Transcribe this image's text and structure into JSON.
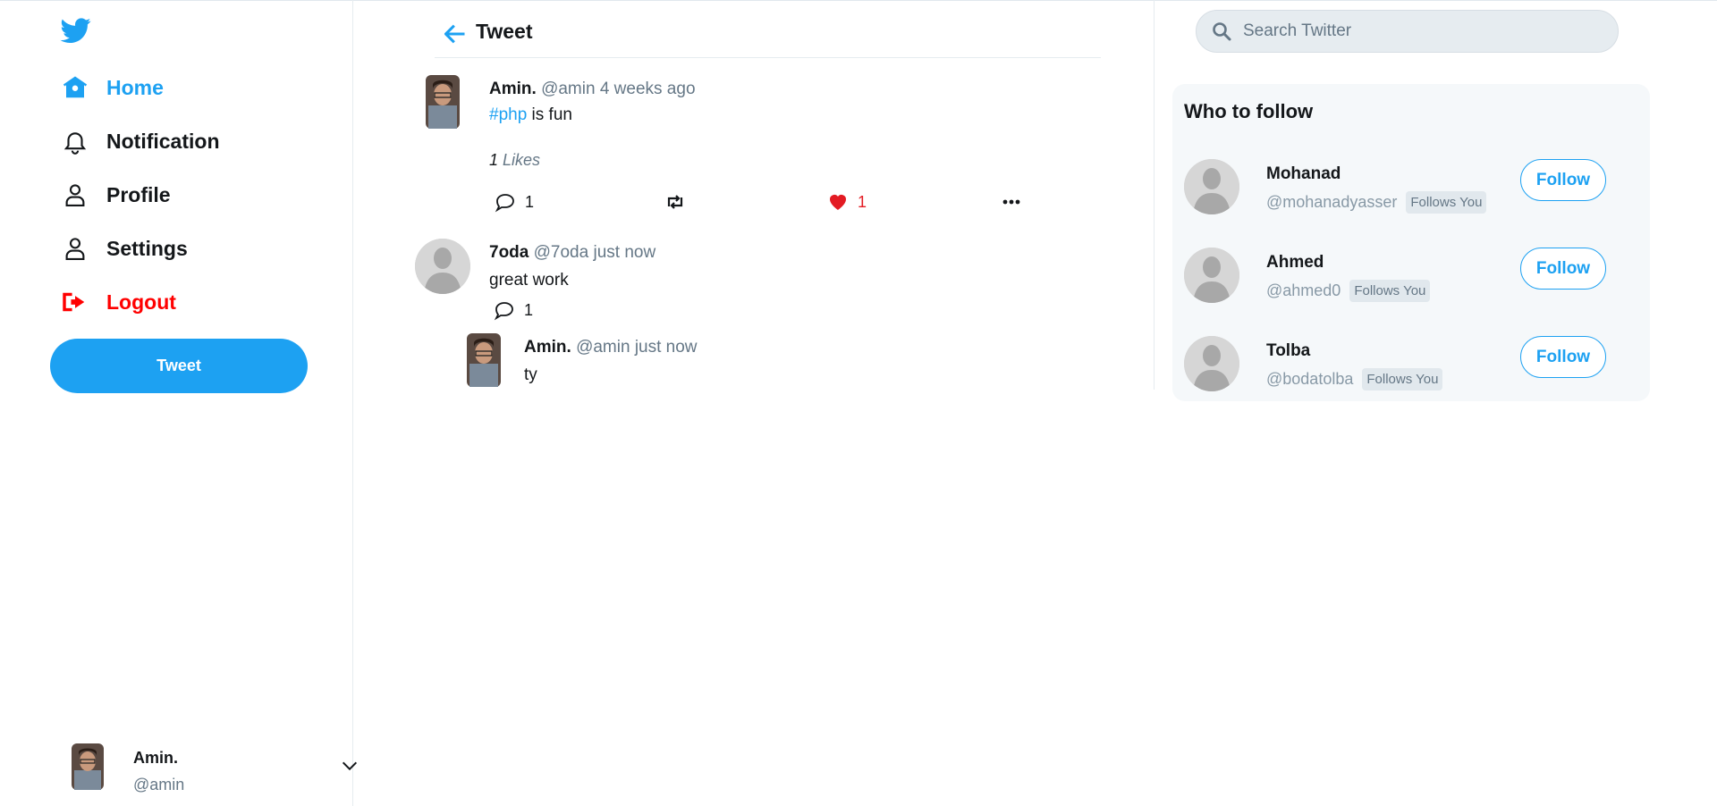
{
  "colors": {
    "accent": "#1da1f2",
    "danger": "#ff0000",
    "like": "#e31b23",
    "muted": "#657786"
  },
  "sidebar": {
    "logo_icon": "twitter-bird-icon",
    "nav": [
      {
        "label": "Home",
        "icon": "home-icon",
        "active": true
      },
      {
        "label": "Notification",
        "icon": "bell-icon"
      },
      {
        "label": "Profile",
        "icon": "user-icon"
      },
      {
        "label": "Settings",
        "icon": "user-icon"
      },
      {
        "label": "Logout",
        "icon": "logout-icon"
      }
    ],
    "tweet_button": "Tweet",
    "account": {
      "name": "Amin.",
      "handle": "@amin",
      "menu_icon": "chevron-down-icon"
    }
  },
  "header": {
    "title": "Tweet",
    "back_icon": "arrow-left-icon"
  },
  "tweet": {
    "name": "Amin.",
    "handle": "@amin",
    "time": "4 weeks ago",
    "hashtag": "#php",
    "text": " is fun",
    "likes_count": "1",
    "likes_label": "Likes",
    "comments": "1",
    "likes": "1",
    "icons": [
      "comment-icon",
      "retweet-icon",
      "heart-icon",
      "more-icon"
    ]
  },
  "comment": {
    "name": "7oda",
    "handle": "@7oda",
    "time": "just now",
    "text": "great work",
    "replies": "1"
  },
  "reply": {
    "name": "Amin.",
    "handle": "@amin",
    "time": "just now",
    "text": "ty"
  },
  "search": {
    "placeholder": "Search Twitter",
    "icon": "search-icon"
  },
  "who_to_follow": {
    "title": "Who to follow",
    "users": [
      {
        "name": "Mohanad",
        "handle": "@mohanadyasser",
        "badge": "Follows You",
        "button": "Follow"
      },
      {
        "name": "Ahmed",
        "handle": "@ahmed0",
        "badge": "Follows You",
        "button": "Follow"
      },
      {
        "name": "Tolba",
        "handle": "@bodatolba",
        "badge": "Follows You",
        "button": "Follow"
      }
    ]
  }
}
